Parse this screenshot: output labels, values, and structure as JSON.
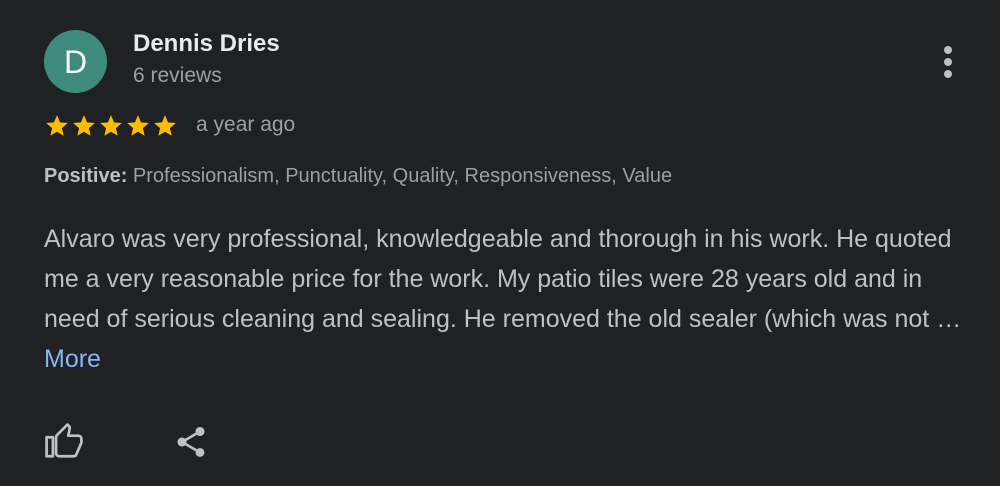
{
  "review": {
    "author": {
      "initial": "D",
      "name": "Dennis Dries",
      "reviews_count": "6 reviews",
      "avatar_color": "#3e8a7d"
    },
    "rating": 5,
    "rating_max": 5,
    "date": "a year ago",
    "attributes": {
      "label": "Positive:",
      "values": "Professionalism, Punctuality, Quality, Responsiveness, Value"
    },
    "text": "Alvaro was very professional, knowledgeable and thorough in his work. He quoted me a very reasonable price for the work. My patio tiles were 28 years old and in need of serious cleaning and sealing. He removed the old sealer (which was not …",
    "more_label": "More"
  },
  "actions": {
    "like_icon": "thumbs-up-icon",
    "share_icon": "share-icon",
    "menu_icon": "more-vert-icon"
  },
  "colors": {
    "background": "#202124",
    "star": "#fbbc04",
    "link": "#8ab4f8",
    "secondary_text": "#9aa0a6"
  }
}
